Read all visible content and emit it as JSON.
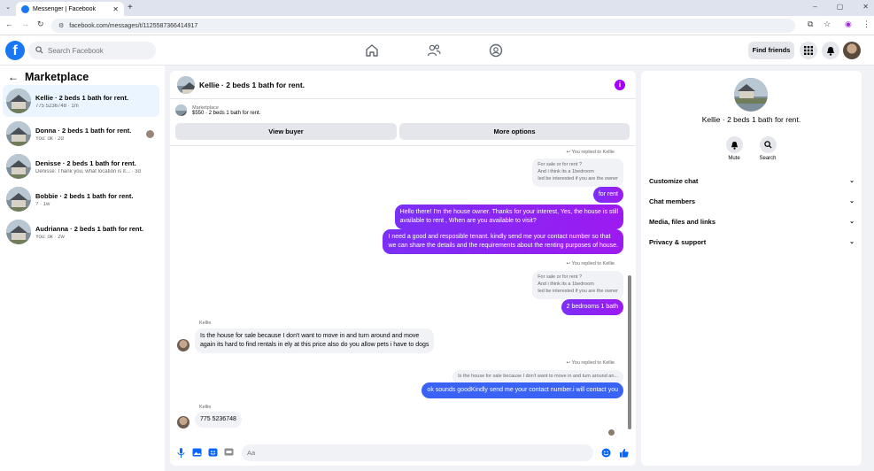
{
  "browser": {
    "tab_title": "Messenger | Facebook",
    "url": "facebook.com/messages/t/1125587366414917"
  },
  "fb": {
    "search_placeholder": "Search Facebook",
    "find_friends": "Find friends",
    "logo_letter": "f"
  },
  "marketplace": {
    "title": "Marketplace",
    "conversations": [
      {
        "name": "Kellie · 2 beds 1 bath for rent.",
        "sub": "775 5236748 · 1m",
        "active": true
      },
      {
        "name": "Donna · 2 beds 1 bath for rent.",
        "sub": "You: ok · 2d",
        "active": false
      },
      {
        "name": "Denisse · 2 beds 1 bath for rent.",
        "sub": "Denisse: Thank you, what location is it... · 3d",
        "active": false
      },
      {
        "name": "Bobbie · 2 beds 1 bath for rent.",
        "sub": "? · 1w",
        "active": false
      },
      {
        "name": "Audrianna · 2 beds 1 bath for rent.",
        "sub": "You: ok · 2w",
        "active": false
      }
    ]
  },
  "chat": {
    "title": "Kellie · 2 beds 1 bath for rent.",
    "listing_label": "Marketplace",
    "listing_detail": "$550 · 2 beds 1 bath for rent.",
    "view_buyer": "View buyer",
    "more_options": "More options",
    "replied_label": "You replied to Kellie",
    "quote1": [
      "For sale or for rent ?",
      "And i think its a 1bedroom",
      "Ied be interested if you are the owner"
    ],
    "msg_for_rent": "for rent",
    "msg_owner": [
      "Hello there! I'm the house owner. Thanks for your interest, Yes, the house is still",
      "available to rent , When are you available to visit?"
    ],
    "msg_tenant": [
      "I need a good and resposible tenant.  kindly send me your contact number so that",
      "we can share the details and the requirements about the renting purposes of house."
    ],
    "msg_bedrooms": "2 bedrooms 1 bath",
    "sender_name": "Kellie",
    "msg_kellie1": [
      "Is the house for sale because I don't want to move in and turn around and move",
      "again its  hard to find rentals in ely at this price also do you allow pets i have to dogs"
    ],
    "quote3": "Is the house for sale because I don't want to move in and turn around an...",
    "msg_contact": "ok sounds goodKindly send me your contact number.i will contact you",
    "msg_kellie2": "775 5236748",
    "composer_placeholder": "Aa"
  },
  "details": {
    "name": "Kellie · 2 beds 1 bath for rent.",
    "mute": "Mute",
    "search": "Search",
    "sections": [
      "Customize chat",
      "Chat members",
      "Media, files and links",
      "Privacy & support"
    ]
  },
  "colors": {
    "accent": "#1877f2",
    "outgoing_purple": "#8a24f5",
    "outgoing_blue": "#3a63f5",
    "info": "#a200ff"
  }
}
